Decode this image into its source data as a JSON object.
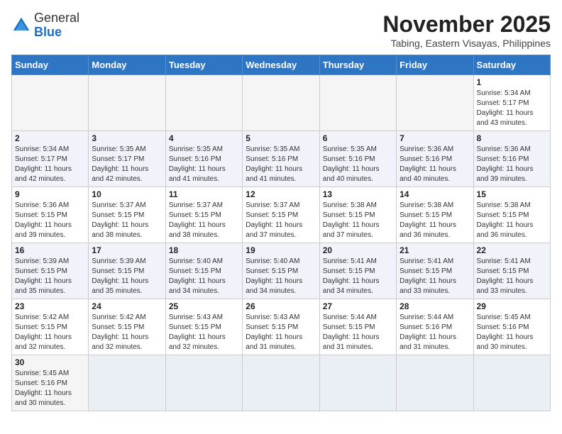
{
  "header": {
    "logo": {
      "general": "General",
      "blue": "Blue"
    },
    "title": "November 2025",
    "subtitle": "Tabing, Eastern Visayas, Philippines"
  },
  "weekdays": [
    "Sunday",
    "Monday",
    "Tuesday",
    "Wednesday",
    "Thursday",
    "Friday",
    "Saturday"
  ],
  "weeks": [
    [
      {
        "day": "",
        "info": ""
      },
      {
        "day": "",
        "info": ""
      },
      {
        "day": "",
        "info": ""
      },
      {
        "day": "",
        "info": ""
      },
      {
        "day": "",
        "info": ""
      },
      {
        "day": "",
        "info": ""
      },
      {
        "day": "1",
        "info": "Sunrise: 5:34 AM\nSunset: 5:17 PM\nDaylight: 11 hours\nand 43 minutes."
      }
    ],
    [
      {
        "day": "2",
        "info": "Sunrise: 5:34 AM\nSunset: 5:17 PM\nDaylight: 11 hours\nand 42 minutes."
      },
      {
        "day": "3",
        "info": "Sunrise: 5:35 AM\nSunset: 5:17 PM\nDaylight: 11 hours\nand 42 minutes."
      },
      {
        "day": "4",
        "info": "Sunrise: 5:35 AM\nSunset: 5:16 PM\nDaylight: 11 hours\nand 41 minutes."
      },
      {
        "day": "5",
        "info": "Sunrise: 5:35 AM\nSunset: 5:16 PM\nDaylight: 11 hours\nand 41 minutes."
      },
      {
        "day": "6",
        "info": "Sunrise: 5:35 AM\nSunset: 5:16 PM\nDaylight: 11 hours\nand 40 minutes."
      },
      {
        "day": "7",
        "info": "Sunrise: 5:36 AM\nSunset: 5:16 PM\nDaylight: 11 hours\nand 40 minutes."
      },
      {
        "day": "8",
        "info": "Sunrise: 5:36 AM\nSunset: 5:16 PM\nDaylight: 11 hours\nand 39 minutes."
      }
    ],
    [
      {
        "day": "9",
        "info": "Sunrise: 5:36 AM\nSunset: 5:15 PM\nDaylight: 11 hours\nand 39 minutes."
      },
      {
        "day": "10",
        "info": "Sunrise: 5:37 AM\nSunset: 5:15 PM\nDaylight: 11 hours\nand 38 minutes."
      },
      {
        "day": "11",
        "info": "Sunrise: 5:37 AM\nSunset: 5:15 PM\nDaylight: 11 hours\nand 38 minutes."
      },
      {
        "day": "12",
        "info": "Sunrise: 5:37 AM\nSunset: 5:15 PM\nDaylight: 11 hours\nand 37 minutes."
      },
      {
        "day": "13",
        "info": "Sunrise: 5:38 AM\nSunset: 5:15 PM\nDaylight: 11 hours\nand 37 minutes."
      },
      {
        "day": "14",
        "info": "Sunrise: 5:38 AM\nSunset: 5:15 PM\nDaylight: 11 hours\nand 36 minutes."
      },
      {
        "day": "15",
        "info": "Sunrise: 5:38 AM\nSunset: 5:15 PM\nDaylight: 11 hours\nand 36 minutes."
      }
    ],
    [
      {
        "day": "16",
        "info": "Sunrise: 5:39 AM\nSunset: 5:15 PM\nDaylight: 11 hours\nand 35 minutes."
      },
      {
        "day": "17",
        "info": "Sunrise: 5:39 AM\nSunset: 5:15 PM\nDaylight: 11 hours\nand 35 minutes."
      },
      {
        "day": "18",
        "info": "Sunrise: 5:40 AM\nSunset: 5:15 PM\nDaylight: 11 hours\nand 34 minutes."
      },
      {
        "day": "19",
        "info": "Sunrise: 5:40 AM\nSunset: 5:15 PM\nDaylight: 11 hours\nand 34 minutes."
      },
      {
        "day": "20",
        "info": "Sunrise: 5:41 AM\nSunset: 5:15 PM\nDaylight: 11 hours\nand 34 minutes."
      },
      {
        "day": "21",
        "info": "Sunrise: 5:41 AM\nSunset: 5:15 PM\nDaylight: 11 hours\nand 33 minutes."
      },
      {
        "day": "22",
        "info": "Sunrise: 5:41 AM\nSunset: 5:15 PM\nDaylight: 11 hours\nand 33 minutes."
      }
    ],
    [
      {
        "day": "23",
        "info": "Sunrise: 5:42 AM\nSunset: 5:15 PM\nDaylight: 11 hours\nand 32 minutes."
      },
      {
        "day": "24",
        "info": "Sunrise: 5:42 AM\nSunset: 5:15 PM\nDaylight: 11 hours\nand 32 minutes."
      },
      {
        "day": "25",
        "info": "Sunrise: 5:43 AM\nSunset: 5:15 PM\nDaylight: 11 hours\nand 32 minutes."
      },
      {
        "day": "26",
        "info": "Sunrise: 5:43 AM\nSunset: 5:15 PM\nDaylight: 11 hours\nand 31 minutes."
      },
      {
        "day": "27",
        "info": "Sunrise: 5:44 AM\nSunset: 5:15 PM\nDaylight: 11 hours\nand 31 minutes."
      },
      {
        "day": "28",
        "info": "Sunrise: 5:44 AM\nSunset: 5:16 PM\nDaylight: 11 hours\nand 31 minutes."
      },
      {
        "day": "29",
        "info": "Sunrise: 5:45 AM\nSunset: 5:16 PM\nDaylight: 11 hours\nand 30 minutes."
      }
    ],
    [
      {
        "day": "30",
        "info": "Sunrise: 5:45 AM\nSunset: 5:16 PM\nDaylight: 11 hours\nand 30 minutes."
      },
      {
        "day": "",
        "info": ""
      },
      {
        "day": "",
        "info": ""
      },
      {
        "day": "",
        "info": ""
      },
      {
        "day": "",
        "info": ""
      },
      {
        "day": "",
        "info": ""
      },
      {
        "day": "",
        "info": ""
      }
    ]
  ]
}
